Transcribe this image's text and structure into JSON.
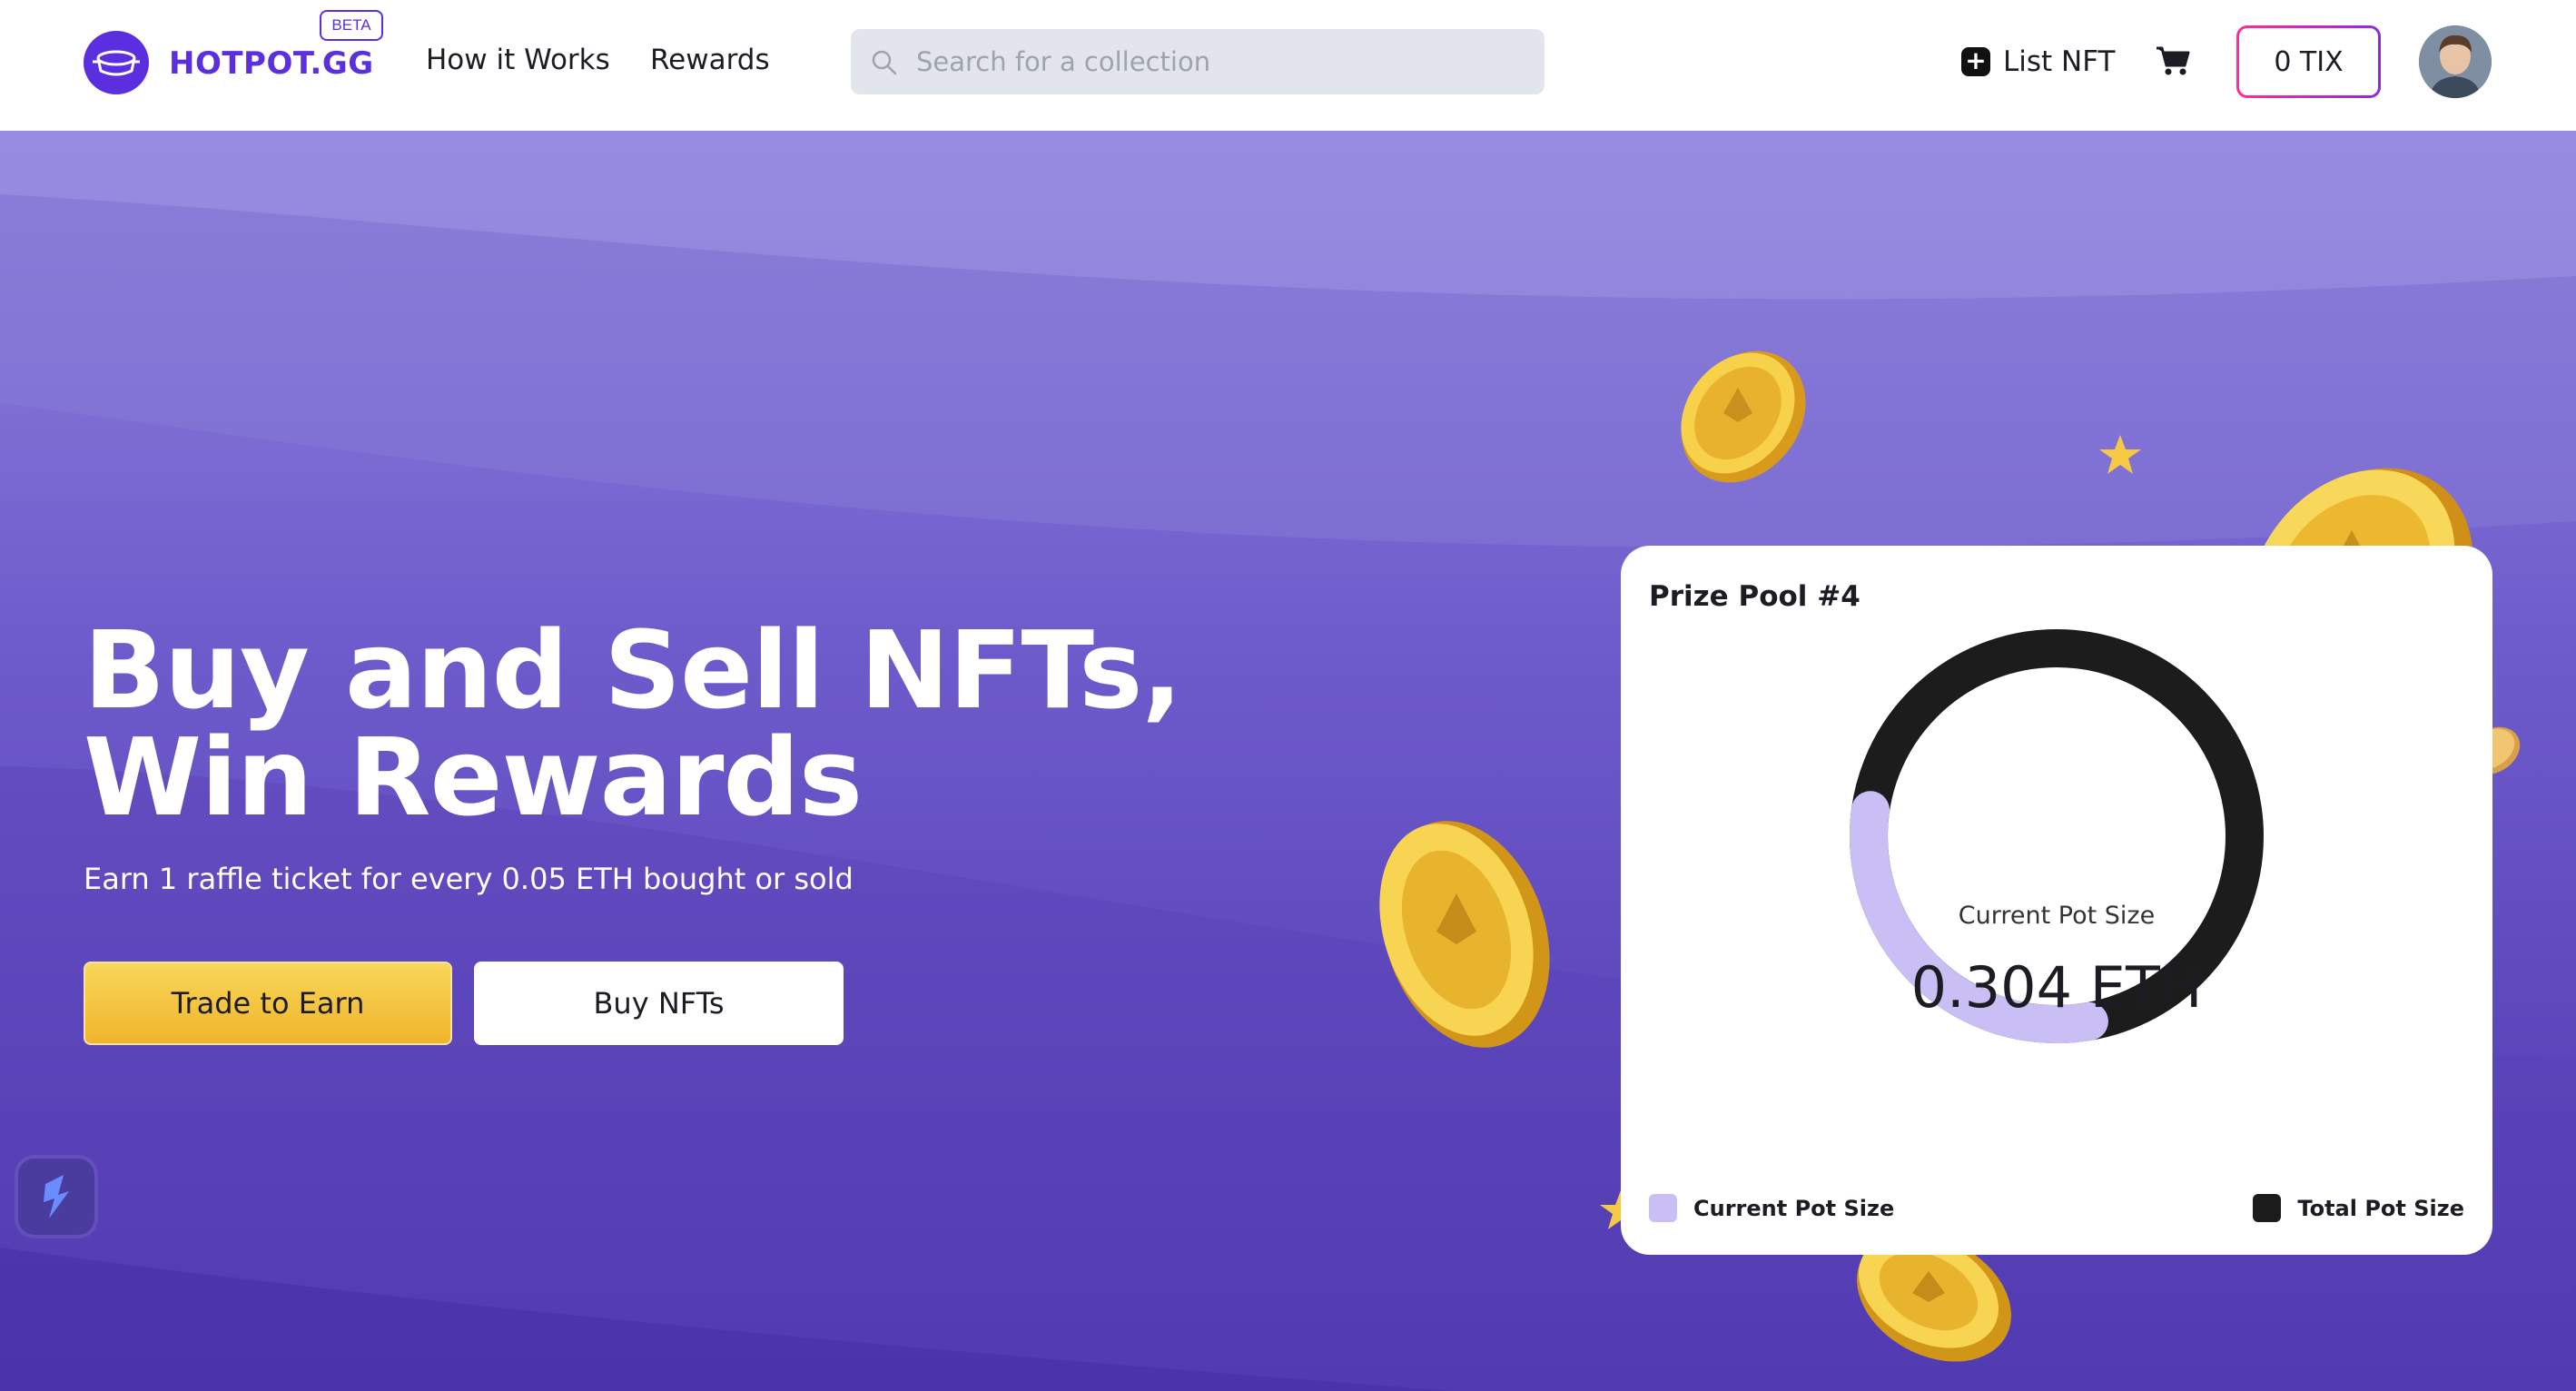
{
  "header": {
    "brand": "HOTPOT.GG",
    "beta_badge": "BETA",
    "nav": {
      "how_it_works": "How it Works",
      "rewards": "Rewards"
    },
    "search": {
      "placeholder": "Search for a collection",
      "icon": "search-icon"
    },
    "list_nft": "List NFT",
    "cart_icon": "cart-icon",
    "tix_button": "0 TIX"
  },
  "hero": {
    "headline_line1": "Buy and Sell NFTs,",
    "headline_line2": "Win Rewards",
    "subline": "Earn 1 raffle ticket for every 0.05 ETH bought or sold",
    "trade_button": "Trade to Earn",
    "buy_button": "Buy NFTs"
  },
  "prize_pool": {
    "title": "Prize Pool #4",
    "center_label": "Current Pot Size",
    "center_value": "0.304 ETH",
    "current_fraction": 0.3,
    "legend": [
      {
        "label": "Current Pot Size",
        "color": "#c9bff5"
      },
      {
        "label": "Total Pot Size",
        "color": "#1c1c1c"
      }
    ]
  },
  "colors": {
    "brand": "#5b2fe0",
    "hero_top": "#8f84dc",
    "hero_bottom": "#4b35ad",
    "gold": "#f4c430"
  }
}
